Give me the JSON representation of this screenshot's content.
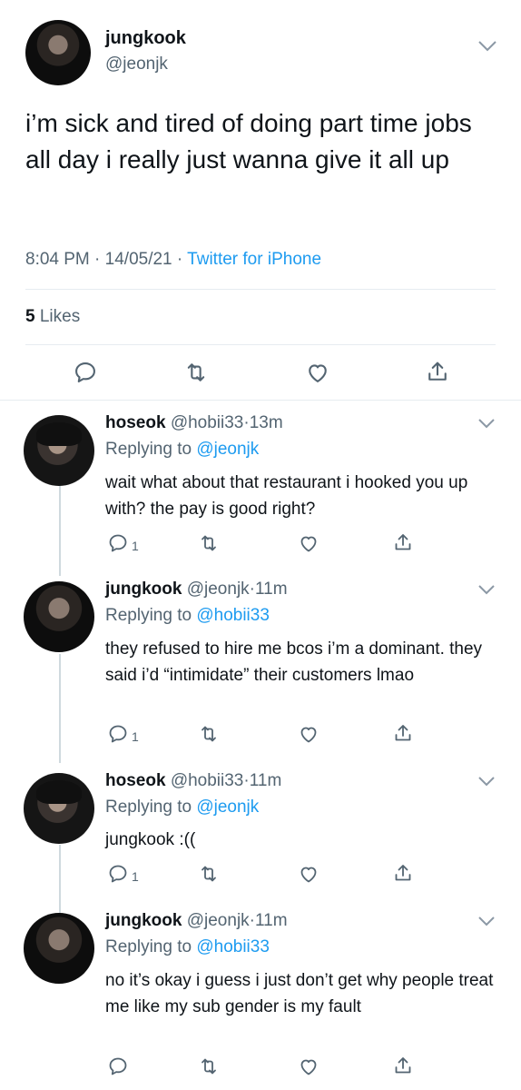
{
  "main_tweet": {
    "display_name": "jungkook",
    "handle": "@jeonjk",
    "text": "i’m sick and tired of doing part time jobs all day i really just wanna give it all up",
    "time": "8:04 PM",
    "date": "14/05/21",
    "source": "Twitter for iPhone",
    "likes_count": "5",
    "likes_label": "Likes"
  },
  "replies": [
    {
      "display_name": "hoseok",
      "handle": "@hobii33",
      "time": "13m",
      "replying_prefix": "Replying to",
      "replying_to": "@jeonjk",
      "text": "wait what about that restaurant i hooked you up with? the pay is good right?",
      "reply_count": "1"
    },
    {
      "display_name": "jungkook",
      "handle": "@jeonjk",
      "time": "11m",
      "replying_prefix": "Replying to",
      "replying_to": "@hobii33",
      "text": "they refused to hire me bcos i’m a dominant. they said i’d “intimidate” their customers lmao",
      "reply_count": "1"
    },
    {
      "display_name": "hoseok",
      "handle": "@hobii33",
      "time": "11m",
      "replying_prefix": "Replying to",
      "replying_to": "@jeonjk",
      "text": "jungkook :((",
      "reply_count": "1"
    },
    {
      "display_name": "jungkook",
      "handle": "@jeonjk",
      "time": "11m",
      "replying_prefix": "Replying to",
      "replying_to": "@hobii33",
      "text": "no it’s okay i guess i just don’t get why people treat me like my sub gender is my fault",
      "reply_count": ""
    }
  ],
  "separators": {
    "dot": "·"
  },
  "icons": {
    "reply": "reply-icon",
    "retweet": "retweet-icon",
    "like": "heart-icon",
    "share": "share-icon",
    "more": "chevron-down-icon"
  },
  "colors": {
    "link": "#1d9bf0",
    "muted": "#536471",
    "text": "#0f1419"
  }
}
